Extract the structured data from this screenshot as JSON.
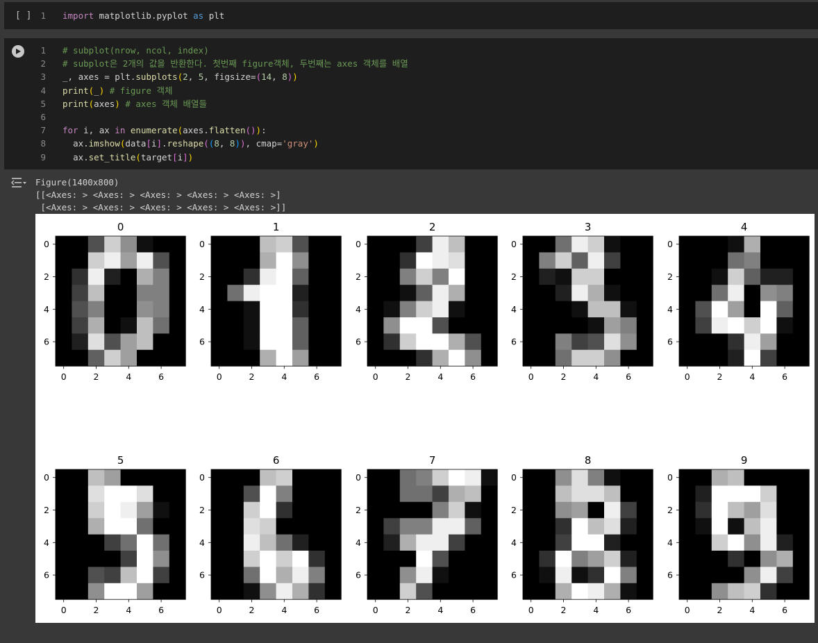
{
  "cell1": {
    "run_label": "[ ]",
    "line_number": "1",
    "code": {
      "kw1": "import",
      "mod": " matplotlib.pyplot ",
      "kw2": "as",
      "alias": " plt"
    }
  },
  "cell2": {
    "lines": [
      {
        "n": "1",
        "t": "# subplot(nrow, ncol, index)"
      },
      {
        "n": "2",
        "t": "# subplot은 2개의 값을 반환한다. 첫번째 figure객체, 두번째는 axes 객체를 배열"
      },
      {
        "n": "3",
        "t": "_, axes = plt.subplots(2, 5, figsize=(14, 8))"
      },
      {
        "n": "4",
        "t": "print(_) # figure 객체"
      },
      {
        "n": "5",
        "t": "print(axes) # axes 객체 배열들"
      },
      {
        "n": "6",
        "t": ""
      },
      {
        "n": "7",
        "t": "for i, ax in enumerate(axes.flatten()):"
      },
      {
        "n": "8",
        "t": "  ax.imshow(data[i].reshape((8, 8)), cmap='gray')"
      },
      {
        "n": "9",
        "t": "  ax.set_title(target[i])"
      }
    ]
  },
  "output": {
    "line1": "Figure(1400x800)",
    "line2": "[[<Axes: > <Axes: > <Axes: > <Axes: > <Axes: >]",
    "line3": " [<Axes: > <Axes: > <Axes: > <Axes: > <Axes: >]]"
  },
  "chart_data": {
    "type": "heatmap",
    "colormap": "gray",
    "rows": 2,
    "cols": 5,
    "tick_labels": [
      "0",
      "2",
      "4",
      "6"
    ],
    "panels": [
      {
        "title": "0",
        "pixels": [
          [
            0,
            0,
            5,
            13,
            9,
            1,
            0,
            0
          ],
          [
            0,
            0,
            13,
            15,
            10,
            15,
            5,
            0
          ],
          [
            0,
            3,
            15,
            2,
            0,
            11,
            8,
            0
          ],
          [
            0,
            4,
            12,
            0,
            0,
            8,
            8,
            0
          ],
          [
            0,
            5,
            8,
            0,
            0,
            9,
            8,
            0
          ],
          [
            0,
            4,
            11,
            0,
            1,
            12,
            7,
            0
          ],
          [
            0,
            2,
            14,
            5,
            10,
            12,
            0,
            0
          ],
          [
            0,
            0,
            6,
            13,
            10,
            0,
            0,
            0
          ]
        ]
      },
      {
        "title": "1",
        "pixels": [
          [
            0,
            0,
            0,
            12,
            13,
            5,
            0,
            0
          ],
          [
            0,
            0,
            0,
            11,
            16,
            9,
            0,
            0
          ],
          [
            0,
            0,
            3,
            15,
            16,
            6,
            0,
            0
          ],
          [
            0,
            7,
            15,
            16,
            16,
            2,
            0,
            0
          ],
          [
            0,
            0,
            1,
            16,
            16,
            3,
            0,
            0
          ],
          [
            0,
            0,
            1,
            16,
            16,
            6,
            0,
            0
          ],
          [
            0,
            0,
            1,
            16,
            16,
            6,
            0,
            0
          ],
          [
            0,
            0,
            0,
            11,
            16,
            10,
            0,
            0
          ]
        ]
      },
      {
        "title": "2",
        "pixels": [
          [
            0,
            0,
            0,
            4,
            15,
            12,
            0,
            0
          ],
          [
            0,
            0,
            3,
            16,
            15,
            14,
            0,
            0
          ],
          [
            0,
            0,
            8,
            13,
            8,
            16,
            0,
            0
          ],
          [
            0,
            0,
            1,
            6,
            15,
            11,
            0,
            0
          ],
          [
            0,
            1,
            8,
            13,
            15,
            1,
            0,
            0
          ],
          [
            0,
            9,
            16,
            16,
            5,
            0,
            0,
            0
          ],
          [
            0,
            3,
            13,
            16,
            16,
            11,
            5,
            0
          ],
          [
            0,
            0,
            0,
            3,
            11,
            16,
            9,
            0
          ]
        ]
      },
      {
        "title": "3",
        "pixels": [
          [
            0,
            0,
            7,
            15,
            13,
            1,
            0,
            0
          ],
          [
            0,
            8,
            13,
            6,
            15,
            4,
            0,
            0
          ],
          [
            0,
            2,
            1,
            13,
            13,
            0,
            0,
            0
          ],
          [
            0,
            0,
            2,
            15,
            11,
            1,
            0,
            0
          ],
          [
            0,
            0,
            0,
            1,
            12,
            12,
            1,
            0
          ],
          [
            0,
            0,
            0,
            0,
            1,
            10,
            8,
            0
          ],
          [
            0,
            0,
            8,
            4,
            5,
            14,
            9,
            0
          ],
          [
            0,
            0,
            7,
            13,
            13,
            9,
            0,
            0
          ]
        ]
      },
      {
        "title": "4",
        "pixels": [
          [
            0,
            0,
            0,
            1,
            11,
            0,
            0,
            0
          ],
          [
            0,
            0,
            0,
            7,
            8,
            0,
            0,
            0
          ],
          [
            0,
            0,
            1,
            13,
            6,
            2,
            2,
            0
          ],
          [
            0,
            0,
            7,
            15,
            0,
            9,
            8,
            0
          ],
          [
            0,
            5,
            16,
            10,
            0,
            16,
            6,
            0
          ],
          [
            0,
            4,
            15,
            16,
            13,
            16,
            1,
            0
          ],
          [
            0,
            0,
            0,
            3,
            15,
            10,
            0,
            0
          ],
          [
            0,
            0,
            0,
            2,
            16,
            4,
            0,
            0
          ]
        ]
      },
      {
        "title": "5",
        "pixels": [
          [
            0,
            0,
            12,
            10,
            0,
            0,
            0,
            0
          ],
          [
            0,
            0,
            14,
            16,
            16,
            14,
            0,
            0
          ],
          [
            0,
            0,
            13,
            16,
            15,
            10,
            1,
            0
          ],
          [
            0,
            0,
            11,
            16,
            16,
            7,
            0,
            0
          ],
          [
            0,
            0,
            0,
            4,
            7,
            16,
            7,
            0
          ],
          [
            0,
            0,
            0,
            0,
            4,
            16,
            9,
            0
          ],
          [
            0,
            0,
            5,
            4,
            12,
            16,
            4,
            0
          ],
          [
            0,
            0,
            9,
            16,
            16,
            10,
            0,
            0
          ]
        ]
      },
      {
        "title": "6",
        "pixels": [
          [
            0,
            0,
            0,
            12,
            13,
            0,
            0,
            0
          ],
          [
            0,
            0,
            5,
            16,
            8,
            0,
            0,
            0
          ],
          [
            0,
            0,
            13,
            16,
            3,
            0,
            0,
            0
          ],
          [
            0,
            0,
            14,
            13,
            0,
            0,
            0,
            0
          ],
          [
            0,
            0,
            15,
            12,
            7,
            2,
            0,
            0
          ],
          [
            0,
            0,
            13,
            16,
            13,
            16,
            3,
            0
          ],
          [
            0,
            0,
            7,
            16,
            11,
            15,
            8,
            0
          ],
          [
            0,
            0,
            1,
            9,
            15,
            11,
            3,
            0
          ]
        ]
      },
      {
        "title": "7",
        "pixels": [
          [
            0,
            0,
            7,
            8,
            13,
            16,
            15,
            1
          ],
          [
            0,
            0,
            7,
            7,
            4,
            11,
            12,
            0
          ],
          [
            0,
            0,
            0,
            0,
            8,
            13,
            1,
            0
          ],
          [
            0,
            4,
            8,
            8,
            15,
            15,
            6,
            0
          ],
          [
            0,
            2,
            11,
            15,
            15,
            4,
            0,
            0
          ],
          [
            0,
            0,
            0,
            16,
            5,
            0,
            0,
            0
          ],
          [
            0,
            0,
            9,
            15,
            1,
            0,
            0,
            0
          ],
          [
            0,
            0,
            13,
            5,
            0,
            0,
            0,
            0
          ]
        ]
      },
      {
        "title": "8",
        "pixels": [
          [
            0,
            0,
            9,
            14,
            8,
            1,
            0,
            0
          ],
          [
            0,
            0,
            12,
            14,
            14,
            12,
            0,
            0
          ],
          [
            0,
            0,
            9,
            10,
            0,
            15,
            4,
            0
          ],
          [
            0,
            0,
            3,
            16,
            12,
            14,
            2,
            0
          ],
          [
            0,
            0,
            4,
            16,
            16,
            2,
            0,
            0
          ],
          [
            0,
            3,
            16,
            8,
            10,
            13,
            2,
            0
          ],
          [
            0,
            1,
            15,
            1,
            3,
            16,
            8,
            0
          ],
          [
            0,
            0,
            11,
            16,
            15,
            11,
            1,
            0
          ]
        ]
      },
      {
        "title": "9",
        "pixels": [
          [
            0,
            0,
            11,
            12,
            0,
            0,
            0,
            0
          ],
          [
            0,
            2,
            16,
            16,
            16,
            13,
            0,
            0
          ],
          [
            0,
            3,
            16,
            12,
            10,
            14,
            0,
            0
          ],
          [
            0,
            1,
            16,
            1,
            12,
            15,
            0,
            0
          ],
          [
            0,
            0,
            13,
            16,
            9,
            15,
            2,
            0
          ],
          [
            0,
            0,
            0,
            3,
            0,
            9,
            11,
            0
          ],
          [
            0,
            0,
            0,
            0,
            9,
            15,
            4,
            0
          ],
          [
            0,
            0,
            9,
            12,
            13,
            3,
            0,
            0
          ]
        ]
      }
    ]
  }
}
